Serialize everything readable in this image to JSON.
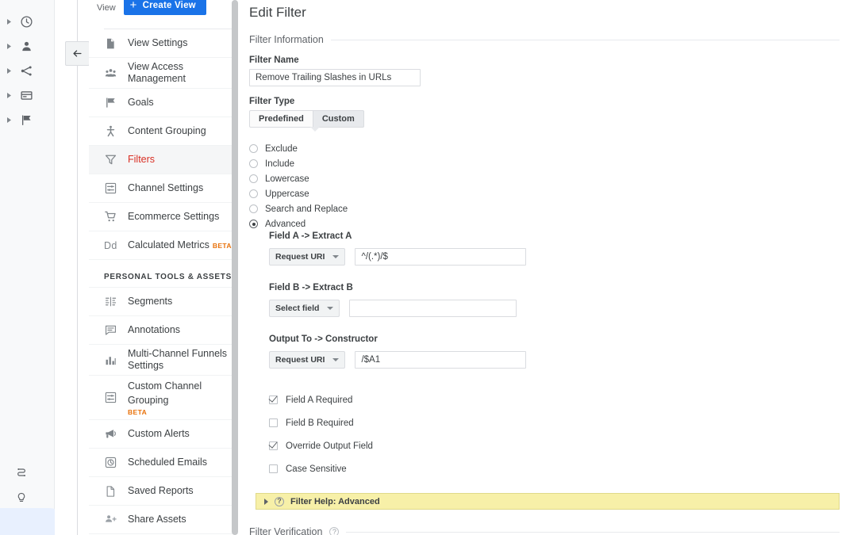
{
  "rail": {
    "items": [
      {
        "icon": "clock-icon",
        "name": "realtime"
      },
      {
        "icon": "person-icon",
        "name": "audience"
      },
      {
        "icon": "acquisition-icon",
        "name": "acquisition"
      },
      {
        "icon": "behavior-icon",
        "name": "behavior"
      },
      {
        "icon": "flag-icon",
        "name": "conversions"
      }
    ],
    "bottom": [
      {
        "icon": "attribution-icon",
        "name": "attribution"
      },
      {
        "icon": "lightbulb-icon",
        "name": "insights"
      }
    ]
  },
  "sidebar": {
    "view_label": "View",
    "create_view_label": "Create View",
    "items": [
      {
        "label": "View Settings",
        "icon": "document-icon",
        "active": false
      },
      {
        "label": "View Access Management",
        "icon": "people-icon",
        "active": false
      },
      {
        "label": "Goals",
        "icon": "flag-icon",
        "active": false
      },
      {
        "label": "Content Grouping",
        "icon": "content-grouping-icon",
        "active": false
      },
      {
        "label": "Filters",
        "icon": "funnel-icon",
        "active": true
      },
      {
        "label": "Channel Settings",
        "icon": "channel-settings-icon",
        "active": false
      },
      {
        "label": "Ecommerce Settings",
        "icon": "cart-icon",
        "active": false
      },
      {
        "label": "Calculated Metrics",
        "icon": "dd-icon",
        "badge": "BETA",
        "active": false
      }
    ],
    "section_title": "PERSONAL TOOLS & ASSETS",
    "personal_items": [
      {
        "label": "Segments",
        "icon": "segments-icon"
      },
      {
        "label": "Annotations",
        "icon": "annotation-icon"
      },
      {
        "label": "Multi-Channel Funnels Settings",
        "icon": "bar-chart-icon"
      },
      {
        "label": "Custom Channel Grouping",
        "icon": "channel-settings-icon",
        "badge": "BETA"
      },
      {
        "label": "Custom Alerts",
        "icon": "megaphone-icon"
      },
      {
        "label": "Scheduled Emails",
        "icon": "schedule-icon"
      },
      {
        "label": "Saved Reports",
        "icon": "document-icon"
      },
      {
        "label": "Share Assets",
        "icon": "person-add-icon"
      }
    ]
  },
  "main": {
    "title": "Edit Filter",
    "filter_information_label": "Filter Information",
    "filter_name_label": "Filter Name",
    "filter_name_value": "Remove Trailing Slashes in URLs",
    "filter_type_label": "Filter Type",
    "toggle": {
      "predefined": "Predefined",
      "custom": "Custom",
      "selected": "Custom"
    },
    "radio_options": [
      {
        "label": "Exclude",
        "selected": false
      },
      {
        "label": "Include",
        "selected": false
      },
      {
        "label": "Lowercase",
        "selected": false
      },
      {
        "label": "Uppercase",
        "selected": false
      },
      {
        "label": "Search and Replace",
        "selected": false
      },
      {
        "label": "Advanced",
        "selected": true
      }
    ],
    "field_a": {
      "label": "Field A -> Extract A",
      "select_value": "Request URI",
      "input_value": "^/(.*)/$"
    },
    "field_b": {
      "label": "Field B -> Extract B",
      "select_value": "Select field",
      "input_value": ""
    },
    "output": {
      "label": "Output To -> Constructor",
      "select_value": "Request URI",
      "input_value": "/$A1"
    },
    "checkboxes": [
      {
        "label": "Field A Required",
        "checked": true
      },
      {
        "label": "Field B Required",
        "checked": false
      },
      {
        "label": "Override Output Field",
        "checked": true
      },
      {
        "label": "Case Sensitive",
        "checked": false
      }
    ],
    "help_bar_label": "Filter Help: Advanced",
    "filter_verification_label": "Filter Verification"
  },
  "colors": {
    "accent_blue": "#1a73e8",
    "active_red": "#d93025",
    "beta_orange": "#e8710a",
    "help_yellow": "#f7f0a8"
  }
}
